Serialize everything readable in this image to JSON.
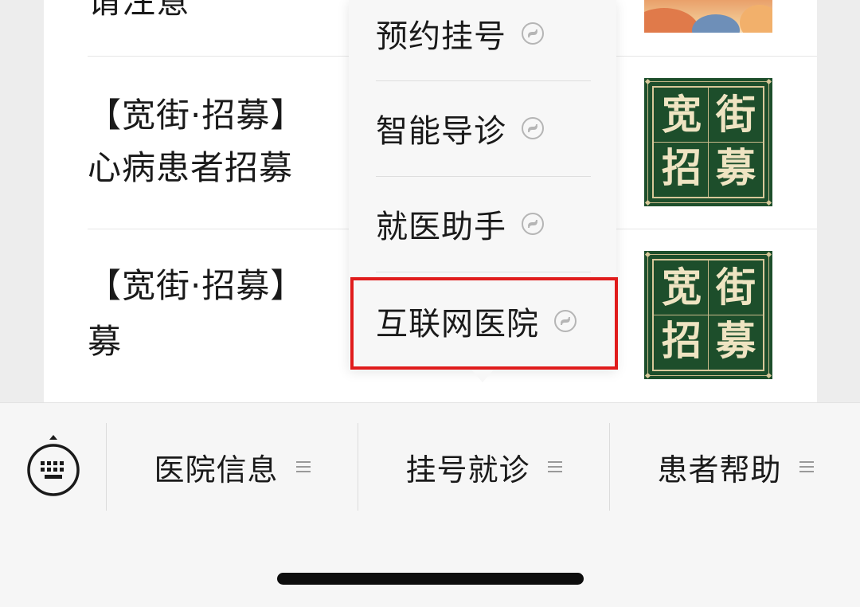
{
  "articles": [
    {
      "title_line1": "请注意",
      "title_line2": ""
    },
    {
      "title_line1": "【宽街·招募】",
      "title_line2": "心病患者招募",
      "thumb_chars": [
        "宽",
        "街",
        "招",
        "募"
      ]
    },
    {
      "title_line1": "【宽街·招募】",
      "title_line2": "募",
      "thumb_chars": [
        "宽",
        "街",
        "招",
        "募"
      ]
    }
  ],
  "popup_menu": {
    "items": [
      {
        "label": "预约挂号",
        "icon": "mini-program-icon"
      },
      {
        "label": "智能导诊",
        "icon": "mini-program-icon"
      },
      {
        "label": "就医助手",
        "icon": "mini-program-icon"
      },
      {
        "label": "互联网医院",
        "icon": "mini-program-icon",
        "highlighted": true
      }
    ],
    "highlight_color": "#e01c1c"
  },
  "bottom_menu": {
    "keyboard_icon": "keyboard-icon",
    "tabs": [
      {
        "label": "医院信息",
        "icon": "menu-lines-icon"
      },
      {
        "label": "挂号就诊",
        "icon": "menu-lines-icon"
      },
      {
        "label": "患者帮助",
        "icon": "menu-lines-icon"
      }
    ]
  },
  "colors": {
    "background": "#ededed",
    "card": "#ffffff",
    "thumb_green": "#1d4e2b",
    "thumb_gold": "#efe4c2",
    "home_indicator": "#0d0d0d"
  }
}
